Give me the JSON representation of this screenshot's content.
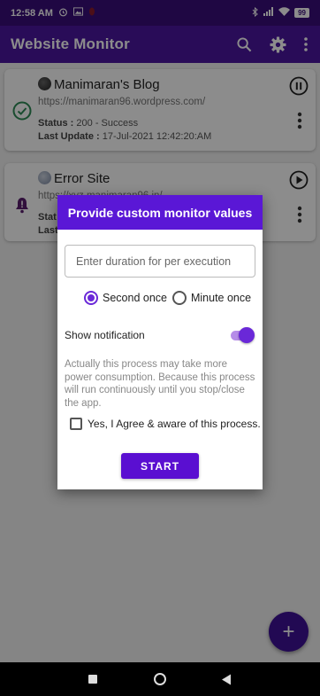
{
  "status_bar": {
    "time": "12:58 AM",
    "battery": "99"
  },
  "app_bar": {
    "title": "Website Monitor",
    "icons": [
      "search-icon",
      "gear-icon",
      "more-vertical-icon"
    ]
  },
  "monitors": [
    {
      "name": "Manimaran's Blog",
      "url": "https://manimaran96.wordpress.com/",
      "status_label": "Status : ",
      "status_value": "200 - Success",
      "last_update_label": "Last Update : ",
      "last_update_value": "17-Jul-2021 12:42:20:AM",
      "state_icon": "check-circle-icon",
      "control_icon": "pause-icon"
    },
    {
      "name": "Error Site",
      "url": "https://xyz.manimaran96.in/",
      "status_label": "Stat",
      "last_update_label": "Last",
      "state_icon": "bell-alert-icon",
      "control_icon": "play-icon"
    }
  ],
  "dialog": {
    "title": "Provide custom monitor values",
    "duration_placeholder": "Enter duration for per execution",
    "radio_options": [
      {
        "label": "Second once",
        "selected": true
      },
      {
        "label": "Minute once",
        "selected": false
      }
    ],
    "show_notification_label": "Show notification",
    "show_notification_on": true,
    "warning_text": "Actually this process may take more power consumption. Because this process will run continuously until you stop/close the app.",
    "agree_label": "Yes, I Agree & aware of this process.",
    "agree_checked": false,
    "start_label": "START"
  },
  "fab": {
    "label": "+"
  },
  "colors": {
    "app_bar": "#4c17a1",
    "status_bar": "#3a0e7a",
    "dialog_header": "#5a17d6",
    "accent": "#6a28d8",
    "success": "#2e8b57",
    "alert": "#5a1e6e"
  }
}
